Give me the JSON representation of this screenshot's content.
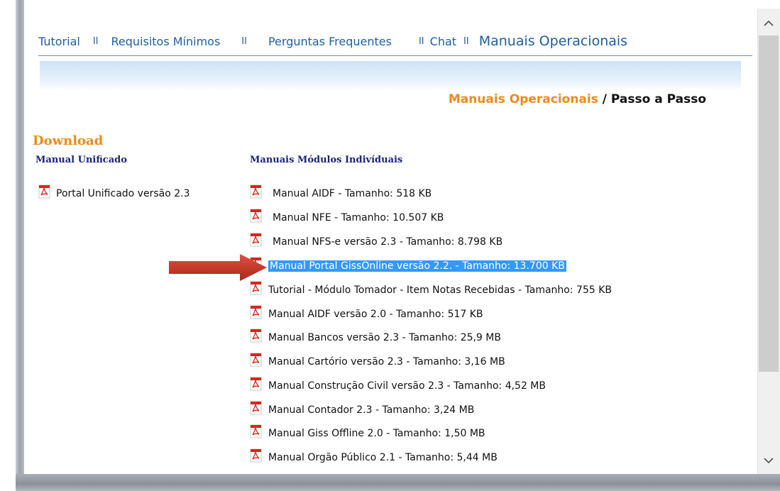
{
  "nav": {
    "tutorial": "Tutorial",
    "requisitos": "Requisitos Mínimos",
    "perguntas": "Perguntas Frequentes",
    "chat": "Chat",
    "manuais": "Manuais Operacionais",
    "separator": "II"
  },
  "breadcrumb": {
    "part1": "Manuais Operacionais",
    "sep": " / ",
    "part2": "Passo a Passo"
  },
  "download_title": "Download",
  "left_column": {
    "title": "Manual Unificado",
    "items": [
      "Portal Unificado versão 2.3"
    ]
  },
  "right_column": {
    "title": "Manuais Módulos Indivíduais",
    "items": [
      "Manual AIDF - Tamanho: 518 KB",
      "Manual NFE - Tamanho: 10.507 KB",
      "Manual NFS-e versão 2.3 - Tamanho: 8.798 KB",
      "Manual Portal GissOnline versão 2.2. - Tamanho: 13.700 KB",
      "Tutorial - Módulo Tomador - Item Notas Recebidas - Tamanho: 755 KB",
      "Manual AIDF versão 2.0 - Tamanho: 517 KB",
      "Manual Bancos versão 2.3 - Tamanho: 25,9 MB",
      "Manual Cartório versão 2.3 - Tamanho: 3,16 MB",
      "Manual Construção Civil versão 2.3 - Tamanho: 4,52 MB",
      "Manual Contador 2.3 - Tamanho: 3,24 MB",
      "Manual Giss Offline 2.0 - Tamanho: 1,50 MB",
      "Manual Orgão Público 2.1 - Tamanho: 5,44 MB"
    ],
    "selected_index": 3
  },
  "icons": {
    "pdf": "pdf-icon",
    "arrow": "red-arrow-icon",
    "scroll_up": "chevron-up-icon",
    "scroll_down": "chevron-down-icon"
  },
  "colors": {
    "nav_link": "#1f5fa0",
    "orange": "#f08a1a",
    "column_title": "#1a237e",
    "selection": "#3399ff",
    "arrow": "#c0392b"
  }
}
